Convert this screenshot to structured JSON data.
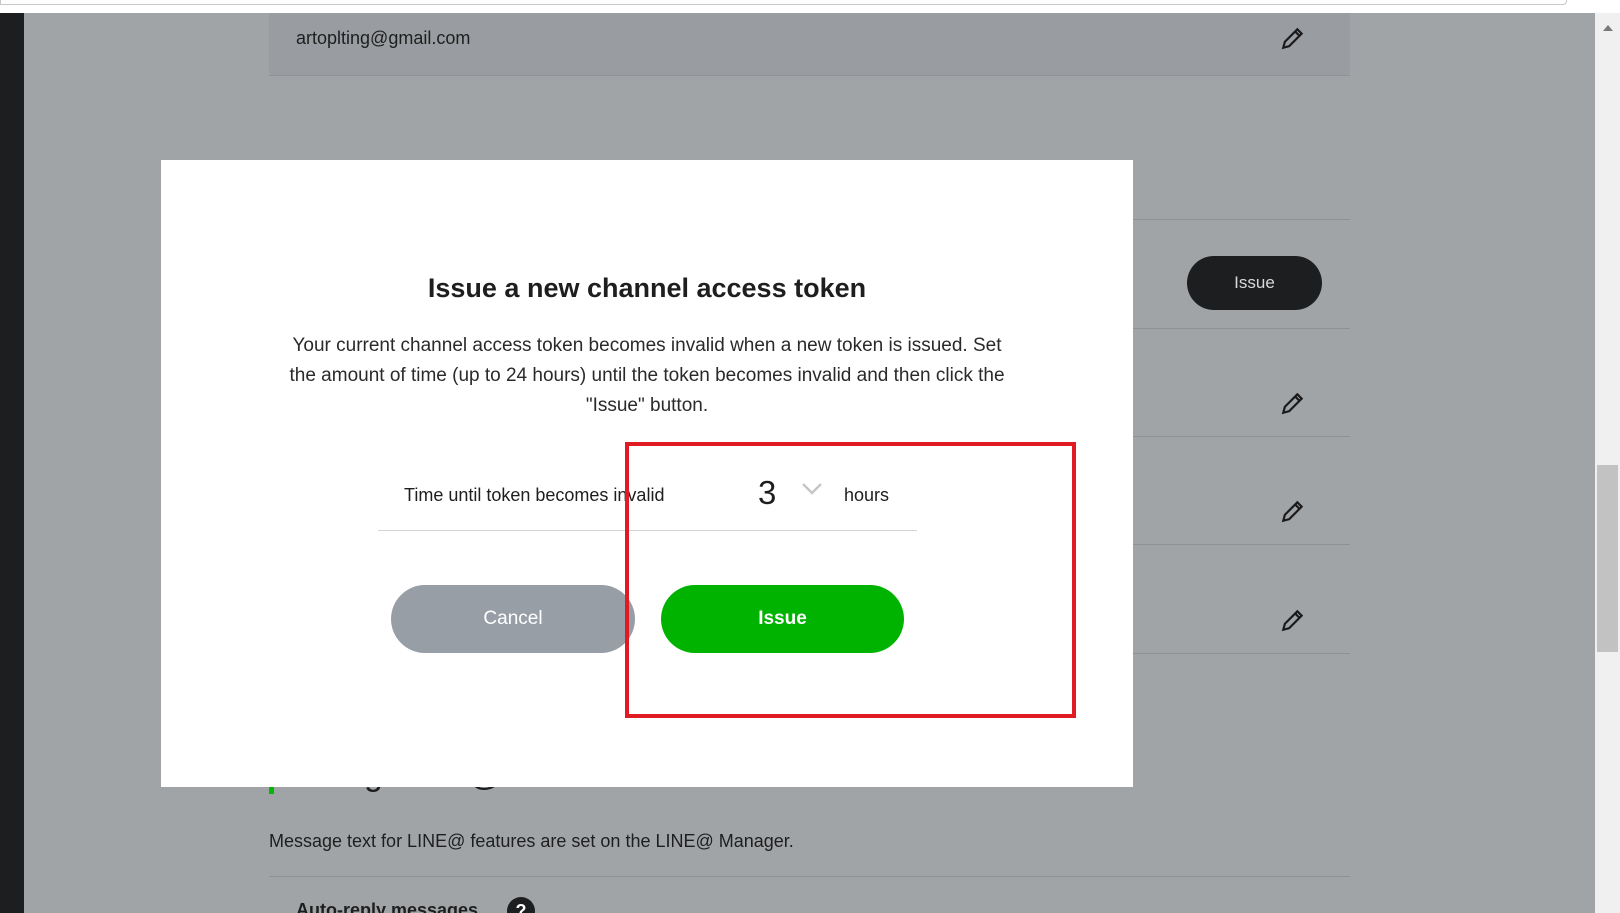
{
  "background": {
    "email": "artoplting@gmail.com",
    "issue_button_label": "Issue",
    "section_title": "Using LINE@ features",
    "section_text": "Message text for LINE@ features are set on the LINE@ Manager.",
    "auto_reply_label": "Auto-reply messages",
    "help_icon_text": "?"
  },
  "modal": {
    "title": "Issue a new channel access token",
    "description": "Your current channel access token becomes invalid when a new token is issued. Set the amount of time (up to 24 hours) until the token becomes invalid and then click the \"Issue\" button.",
    "field_label": "Time until token becomes invalid",
    "hours_value": "3",
    "hours_unit": "hours",
    "cancel_label": "Cancel",
    "issue_label": "Issue"
  },
  "colors": {
    "overlay": "#a1a4a7",
    "issue_green": "#00b300",
    "cancel_gray": "#979ea6",
    "highlight_red": "#e01b24"
  }
}
